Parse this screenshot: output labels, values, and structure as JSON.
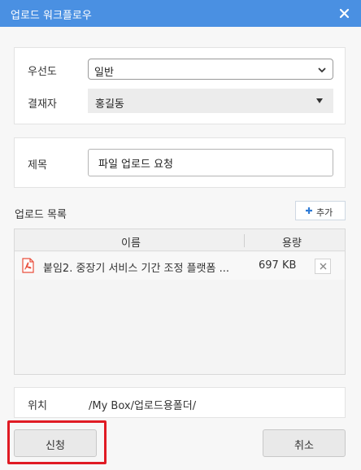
{
  "window": {
    "title": "업로드 워크플로우",
    "close_icon": "close-icon"
  },
  "settings": {
    "priority_label": "우선도",
    "priority_value": "일반",
    "approver_label": "결재자",
    "approver_value": "홍길동"
  },
  "subject": {
    "label": "제목",
    "value": "파일 업로드 요청"
  },
  "upload_list": {
    "title": "업로드 목록",
    "add_label": "추가",
    "columns": {
      "name": "이름",
      "size": "용량"
    },
    "files": [
      {
        "name": "붙임2. 중장기 서비스 기간 조정 플랫폼 ...",
        "size": "697 KB",
        "icon": "pdf-file-icon"
      }
    ]
  },
  "location": {
    "label": "위치",
    "value": "/My Box/업로드용폴더/"
  },
  "actions": {
    "submit_label": "신청",
    "cancel_label": "취소"
  },
  "colors": {
    "titlebar": "#4a90e2",
    "accent": "#2f7bd6",
    "highlight": "#e01b24",
    "pdf": "#e94e3c"
  }
}
